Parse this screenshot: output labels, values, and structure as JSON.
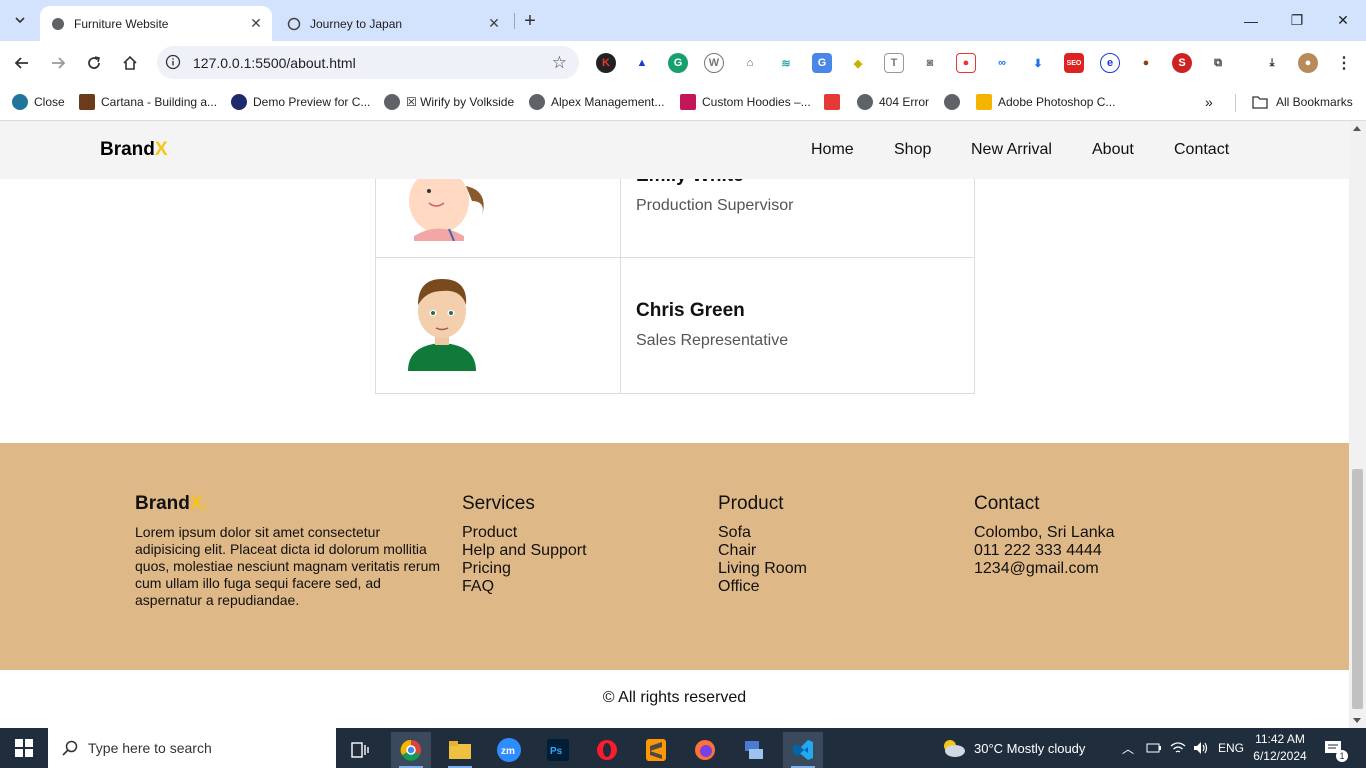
{
  "browser": {
    "tabs": [
      {
        "title": "Furniture Website",
        "active": true
      },
      {
        "title": "Journey to Japan",
        "active": false
      }
    ],
    "url": "127.0.0.1:5500/about.html",
    "bookmarks": [
      {
        "label": "Close"
      },
      {
        "label": "Cartana - Building a..."
      },
      {
        "label": "Demo Preview for C..."
      },
      {
        "label": "☒ Wirify by Volkside"
      },
      {
        "label": "Alpex Management..."
      },
      {
        "label": "Custom Hoodies –..."
      },
      {
        "label": ""
      },
      {
        "label": "404 Error"
      },
      {
        "label": ""
      },
      {
        "label": "Adobe Photoshop C..."
      }
    ],
    "all_bookmarks": "All Bookmarks"
  },
  "site": {
    "brand": "Brand",
    "brand_accent": "X",
    "nav": [
      "Home",
      "Shop",
      "New Arrival",
      "About",
      "Contact"
    ]
  },
  "team": [
    {
      "name": "Emily White",
      "role": "Production Supervisor",
      "avatar": "girl-avatar"
    },
    {
      "name": "Chris Green",
      "role": "Sales Representative",
      "avatar": "boy-avatar"
    }
  ],
  "footer": {
    "brand": "Brand",
    "brand_accent": "X.",
    "about": "Lorem ipsum dolor sit amet consectetur adipisicing elit. Placeat dicta id dolorum mollitia quos, molestiae nesciunt magnam veritatis rerum cum ullam illo fuga sequi facere sed, ad aspernatur a repudiandae.",
    "columns": [
      {
        "title": "Services",
        "links": [
          "Product",
          "Help and Support",
          "Pricing",
          "FAQ"
        ]
      },
      {
        "title": "Product",
        "links": [
          "Sofa",
          "Chair",
          "Living Room",
          "Office"
        ]
      },
      {
        "title": "Contact",
        "links": [
          "Colombo, Sri Lanka",
          "011 222 333 4444",
          "1234@gmail.com"
        ]
      }
    ],
    "copyright": "© All rights reserved"
  },
  "taskbar": {
    "search_placeholder": "Type here to search",
    "weather": "30°C  Mostly cloudy",
    "language": "ENG",
    "time": "11:42 AM",
    "date": "6/12/2024",
    "notification_count": "1"
  },
  "colors": {
    "footer_bg": "#dfb887",
    "brand_accent": "#f5c518",
    "header_bg": "#f4f4f4"
  }
}
